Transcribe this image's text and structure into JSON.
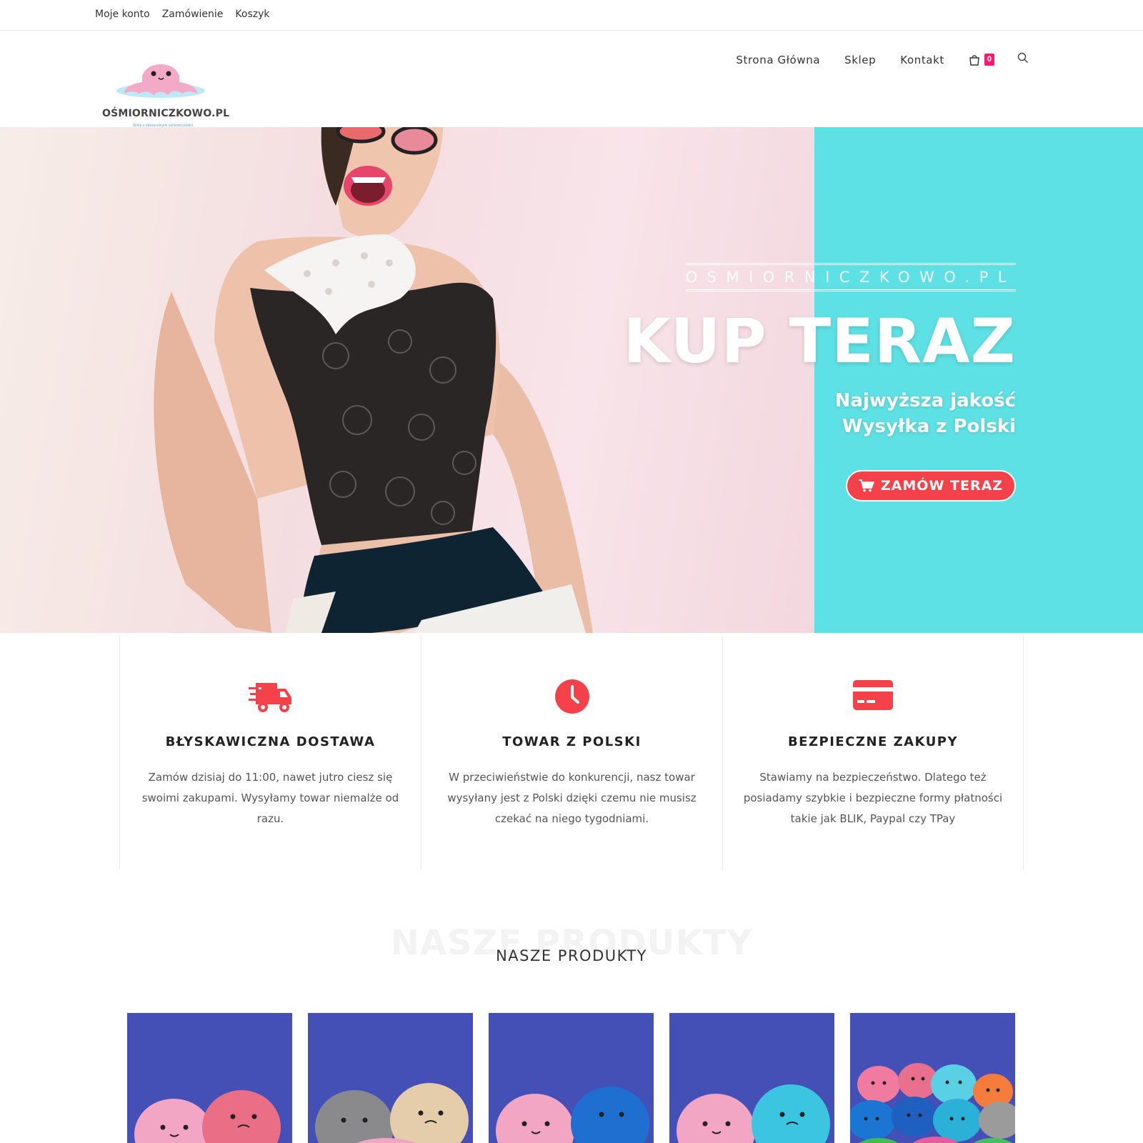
{
  "topbar": {
    "links": [
      "Moje konto",
      "Zamówienie",
      "Koszyk"
    ]
  },
  "header": {
    "logo_name": "OŚMIORNICZKOWO.PL",
    "logo_tagline": "Sklep z odwracalnymi ośmiorniczkami",
    "nav": [
      "Strona Główna",
      "Sklep",
      "Kontakt"
    ],
    "cart_count": "0",
    "icons": [
      "cart-icon",
      "search-icon"
    ]
  },
  "hero": {
    "brand": "OSMIORNICZKOWO.PL",
    "title": "KUP TERAZ",
    "subtitle_line1": "Najwyższa jakość",
    "subtitle_line2": "Wysyłka z Polski",
    "button_label": "ZAMÓW TERAZ",
    "accent_color": "#5ee1e4",
    "button_color": "#f5424a"
  },
  "features": [
    {
      "icon": "delivery-truck-icon",
      "title": "BŁYSKAWICZNA DOSTAWA",
      "text": "Zamów dzisiaj do 11:00, nawet jutro ciesz się swoimi zakupami. Wysyłamy towar niemalże od razu."
    },
    {
      "icon": "clock-icon",
      "title": "TOWAR Z POLSKI",
      "text": "W przeciwieństwie do konkurencji, nasz towar wysyłany jest z Polski dzięki czemu nie musisz czekać na niego tygodniami."
    },
    {
      "icon": "credit-card-icon",
      "title": "BEZPIECZNE ZAKUPY",
      "text": "Stawiamy na bezpieczeństwo. Dlatego też posiadamy szybkie i bezpieczne formy płatności takie jak BLIK, Paypal czy TPay"
    }
  ],
  "products_section": {
    "bg_title": "NASZE PRODUKTY",
    "title": "NASZE PRODUKTY",
    "product_images": [
      "octopus-pink-red",
      "octopus-gray-beige",
      "octopus-pink-blue",
      "octopus-pink-turquoise",
      "octopus-group"
    ]
  },
  "colors": {
    "badge": "#ff1a6e",
    "icon_red": "#f5424a",
    "product_bg": "#4450b5"
  }
}
